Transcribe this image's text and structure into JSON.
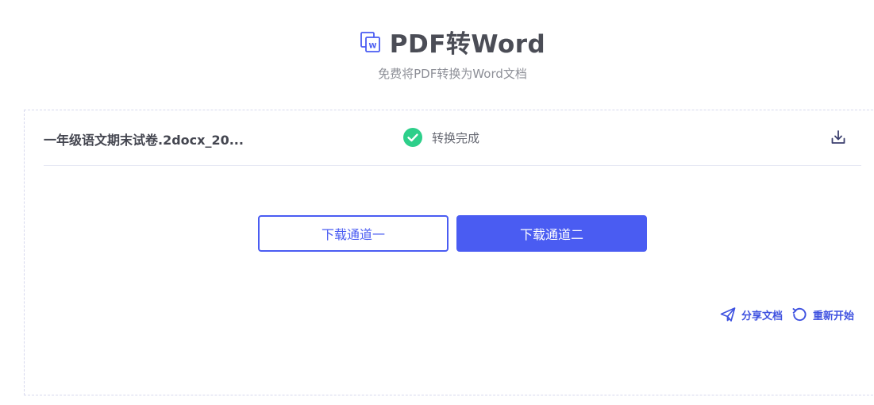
{
  "header": {
    "title": "PDF转Word",
    "subtitle": "免费将PDF转换为Word文档",
    "icon": "word-file-icon"
  },
  "file": {
    "name": "一年级语文期末试卷.2docx_20...",
    "status_text": "转换完成",
    "status_icon": "check-circle-icon",
    "download_icon": "download-icon"
  },
  "buttons": {
    "channel_one": "下载通道一",
    "channel_two": "下载通道二"
  },
  "actions": {
    "share": "分享文档",
    "restart": "重新开始"
  },
  "colors": {
    "accent": "#4a5cf2",
    "success": "#2dcf8a",
    "title": "#4b4d56",
    "subtitle": "#8d8f97"
  }
}
